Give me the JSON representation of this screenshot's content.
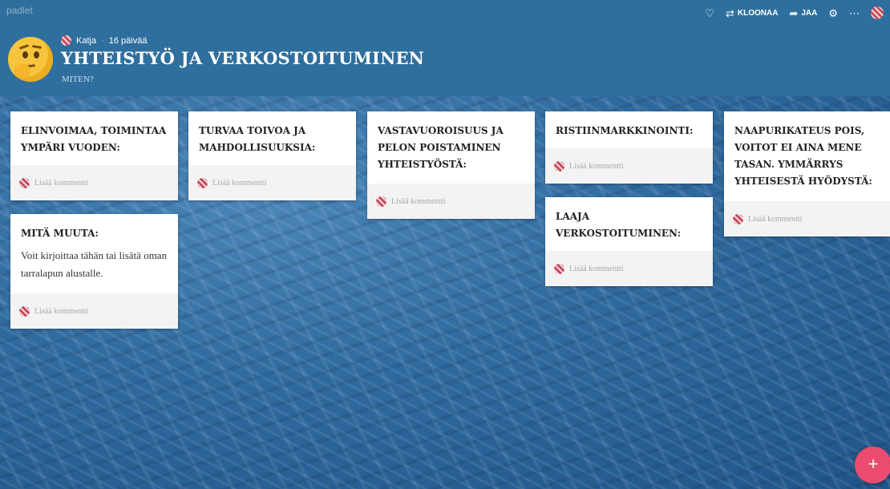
{
  "app": {
    "logo_text": "padlet"
  },
  "header": {
    "author": "Katja",
    "time_ago": "16 päivää",
    "title": "YHTEISTYÖ JA VERKOSTOITUMINEN",
    "subtitle": "MITEN?",
    "separator": "·"
  },
  "toolbar": {
    "like_icon": "♡",
    "clone_icon": "⇄",
    "clone_label": "KLOONAA",
    "share_icon": "➦",
    "share_label": "JAA",
    "settings_icon": "⚙",
    "more_icon": "⋯"
  },
  "cards": [
    {
      "title": "ELINVOIMAA, TOIMINTAA YMPÄRI VUODEN:",
      "text": "",
      "comment_placeholder": "Lisää kommentti"
    },
    {
      "title": "MITÄ MUUTA:",
      "text": "Voit kirjoittaa tähän tai lisätä oman tarralapun alustalle.",
      "comment_placeholder": "Lisää kommentti"
    },
    {
      "title": "TURVAA TOIVOA JA MAHDOLLISUUKSIA:",
      "text": "",
      "comment_placeholder": "Lisää kommentti"
    },
    {
      "title": "VASTAVUOROISUUS JA PELON POISTAMINEN YHTEISTYÖSTÄ:",
      "text": "",
      "comment_placeholder": "Lisää kommentti"
    },
    {
      "title": "RISTIINMARKKINOINTI:",
      "text": "",
      "comment_placeholder": "Lisää kommentti"
    },
    {
      "title": "LAAJA VERKOSTOITUMINEN:",
      "text": "",
      "comment_placeholder": "Lisää kommentti"
    },
    {
      "title": "NAAPURIKATEUS POIS, VOITOT EI AINA MENE TASAN. YMMÄRRYS YHTEISESTÄ HYÖDYSTÄ:",
      "text": "",
      "comment_placeholder": "Lisää kommentti"
    }
  ],
  "fab": {
    "label": "+"
  },
  "colors": {
    "header_bg": "#2f6f9e",
    "fab_bg": "#ea4c6f",
    "card_footer_bg": "#f3f3f3"
  }
}
